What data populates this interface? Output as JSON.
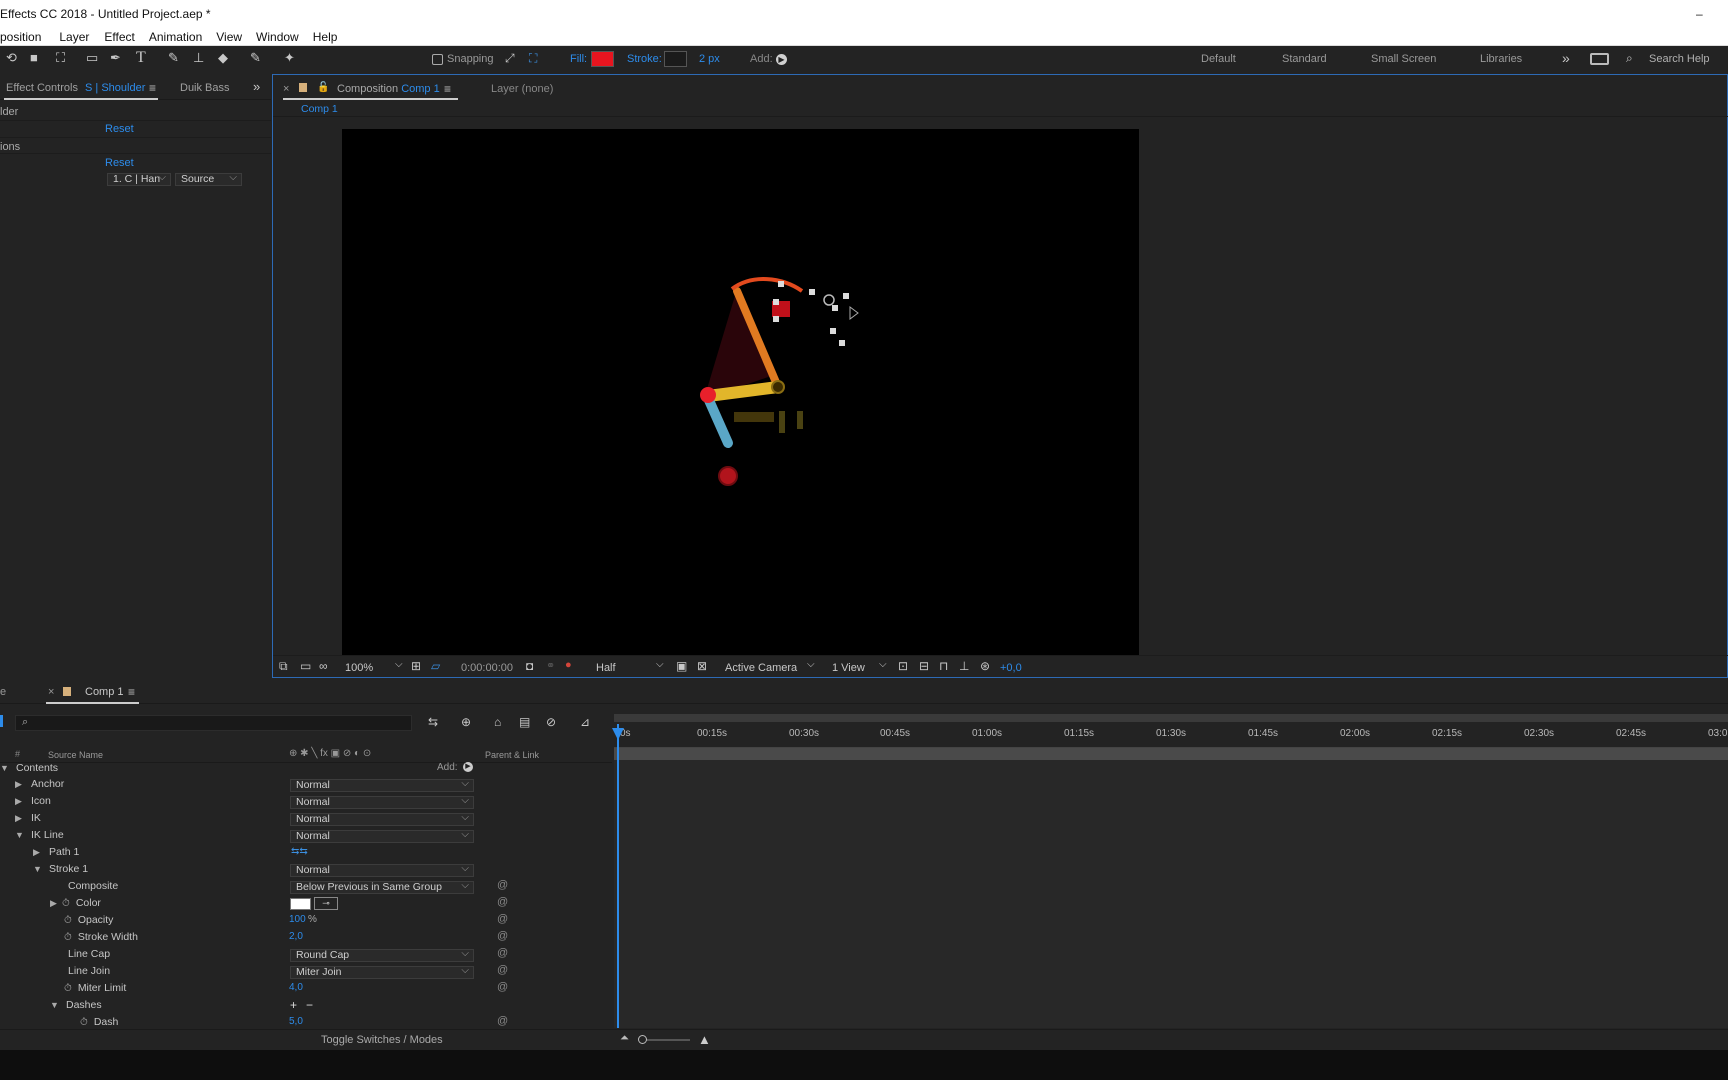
{
  "titlebar": {
    "title": "Effects CC 2018 - Untitled Project.aep *",
    "minimize": "–"
  },
  "menu": [
    "position",
    "Layer",
    "Effect",
    "Animation",
    "View",
    "Window",
    "Help"
  ],
  "toolbar": {
    "snapping": "Snapping",
    "fill_label": "Fill:",
    "fill_color": "#e8151f",
    "stroke_label": "Stroke:",
    "stroke_width": "2 px",
    "add_label": "Add:",
    "workspaces": [
      "Default",
      "Standard",
      "Small Screen",
      "Libraries"
    ],
    "search_help": "Search Help"
  },
  "effect_panel": {
    "tab_label": "Effect Controls",
    "tab_layer": "S | Shoulder",
    "tab2": "Duik Bass",
    "row1_label": "lder",
    "reset1": "Reset",
    "row2_label": "ions",
    "reset2": "Reset",
    "select_a": "1. C | Han",
    "select_b": "Source"
  },
  "comp_panel": {
    "tab_prefix": "Composition",
    "tab_name": "Comp 1",
    "layer_tab": "Layer (none)",
    "breadcrumb": "Comp 1"
  },
  "viewer_bar": {
    "zoom": "100%",
    "timecode": "0:00:00:00",
    "resolution": "Half",
    "camera": "Active Camera",
    "views": "1 View",
    "exposure": "+0,0"
  },
  "timeline": {
    "tab_name": "Comp 1",
    "tab_left": "e",
    "col_source": "Source Name",
    "col_parent": "Parent & Link",
    "add_label": "Add:",
    "contents_label": "Contents",
    "ruler": [
      "0s",
      "00:15s",
      "00:30s",
      "00:45s",
      "01:00s",
      "01:15s",
      "01:30s",
      "01:45s",
      "02:00s",
      "02:15s",
      "02:30s",
      "02:45s",
      "03:0"
    ],
    "layers": [
      {
        "name": "Anchor",
        "mode": "Normal"
      },
      {
        "name": "Icon",
        "mode": "Normal"
      },
      {
        "name": "IK",
        "mode": "Normal"
      },
      {
        "name": "IK Line",
        "mode": "Normal"
      },
      {
        "name": "Path 1",
        "mode": ""
      },
      {
        "name": "Stroke 1",
        "mode": "Normal"
      },
      {
        "name": "Composite",
        "mode": "Below Previous in Same Group"
      },
      {
        "name": "Color",
        "mode": ""
      },
      {
        "name": "Opacity",
        "value": "100",
        "unit": "%"
      },
      {
        "name": "Stroke Width",
        "value": "2,0"
      },
      {
        "name": "Line Cap",
        "mode": "Round Cap"
      },
      {
        "name": "Line Join",
        "mode": "Miter Join"
      },
      {
        "name": "Miter Limit",
        "value": "4,0"
      },
      {
        "name": "Dashes",
        "mode": ""
      },
      {
        "name": "Dash",
        "value": "5,0"
      }
    ],
    "toggle_label": "Toggle Switches / Modes"
  }
}
